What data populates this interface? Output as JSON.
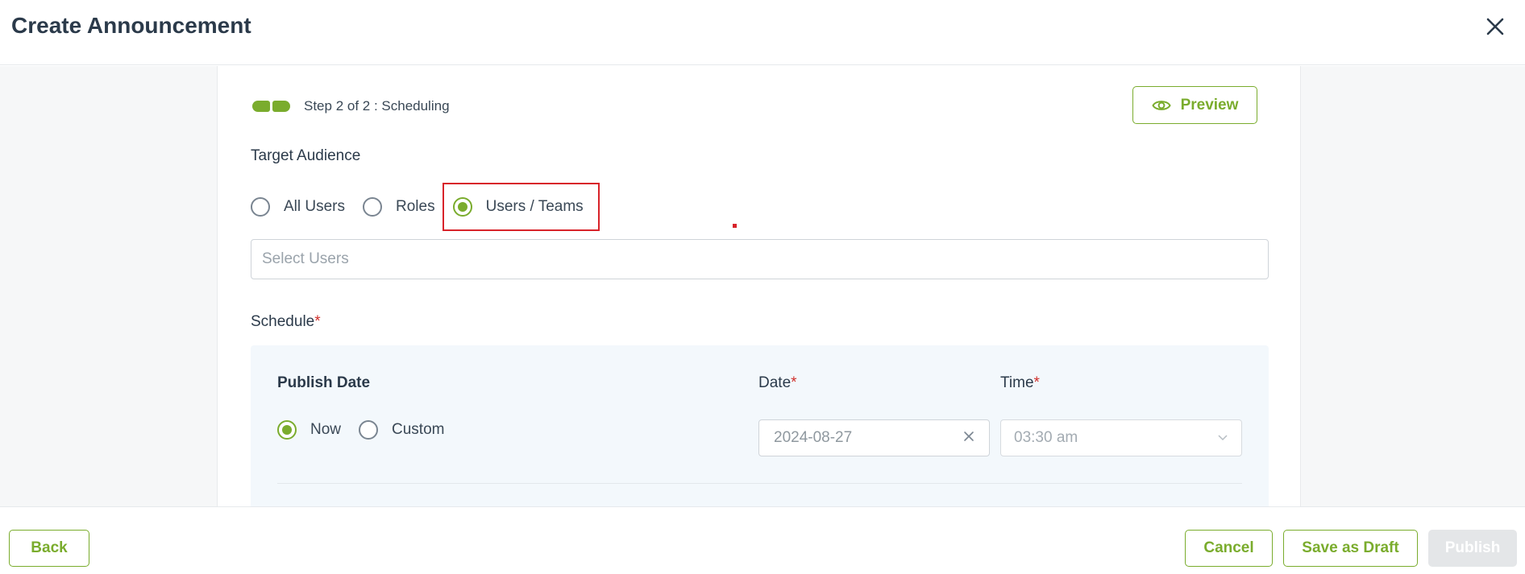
{
  "header": {
    "title": "Create Announcement"
  },
  "stepper": {
    "text": "Step 2 of 2 : Scheduling"
  },
  "preview": {
    "label": "Preview"
  },
  "target_audience": {
    "label": "Target Audience",
    "options": [
      {
        "label": "All Users",
        "checked": false
      },
      {
        "label": "Roles",
        "checked": false
      },
      {
        "label": "Users / Teams",
        "checked": true
      }
    ],
    "select_placeholder": "Select Users"
  },
  "schedule": {
    "label": "Schedule",
    "required_mark": "*",
    "publish_date": {
      "title": "Publish Date",
      "options": [
        {
          "label": "Now",
          "checked": true
        },
        {
          "label": "Custom",
          "checked": false
        }
      ]
    },
    "date": {
      "label": "Date",
      "value": "2024-08-27"
    },
    "time": {
      "label": "Time",
      "value": "03:30 am"
    }
  },
  "footer": {
    "back": "Back",
    "cancel": "Cancel",
    "save_draft": "Save as Draft",
    "publish": "Publish"
  },
  "colors": {
    "accent": "#7aac2d",
    "required": "#d0312d",
    "highlight": "#d8232a",
    "schedule_bg": "#f3f8fc"
  },
  "icons": {
    "close": "close-icon",
    "preview": "eye-icon",
    "clear": "clear-icon",
    "dropdown": "chevron-down-icon"
  }
}
